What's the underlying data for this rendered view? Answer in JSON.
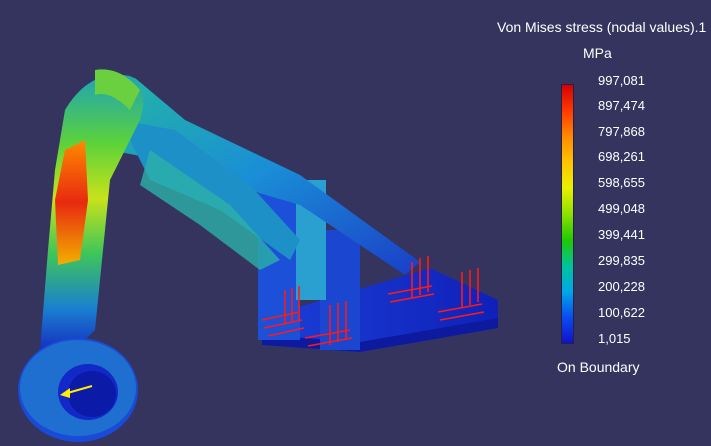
{
  "legend": {
    "title": "Von Mises stress (nodal values).1",
    "unit": "MPa",
    "ticks": [
      "997,081",
      "897,474",
      "797,868",
      "698,261",
      "598,655",
      "499,048",
      "399,441",
      "299,835",
      "200,228",
      "100,622",
      "1,015"
    ],
    "footer": "On Boundary"
  },
  "colors": {
    "background": "#34345f",
    "max_stress": "#d40000",
    "min_stress": "#1212c8",
    "restraint_arrows": "#ff1a1a",
    "load_arrow": "#ffee00"
  },
  "icons": {
    "restraint": "restraint-arrow-icon",
    "load": "load-arrow-icon"
  }
}
